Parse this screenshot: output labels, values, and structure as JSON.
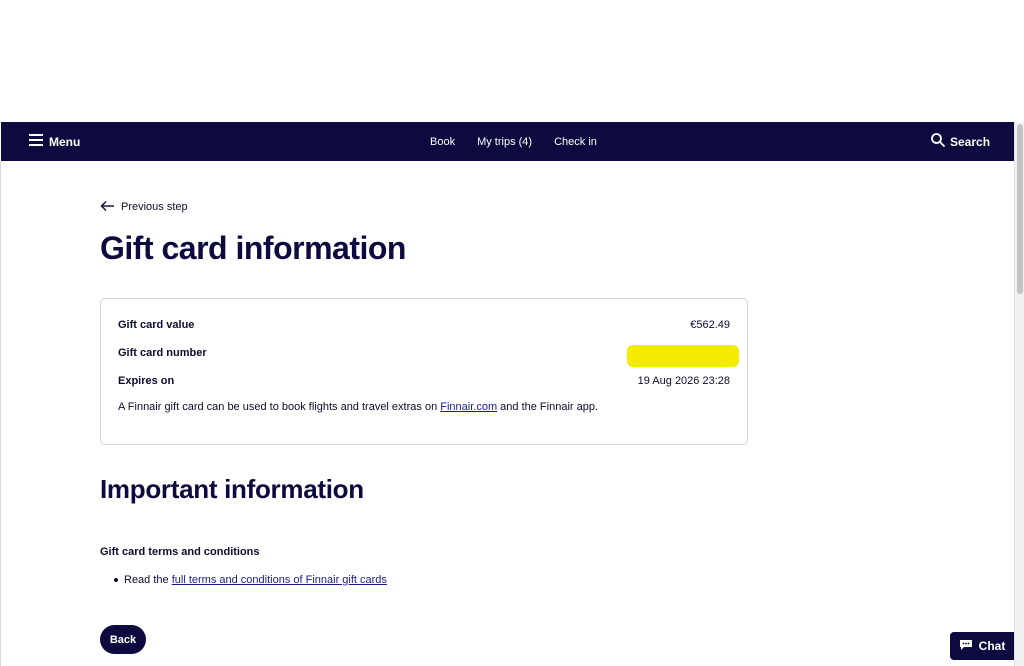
{
  "nav": {
    "menu_label": "Menu",
    "links": [
      "Book",
      "My trips (4)",
      "Check in"
    ],
    "search_label": "Search"
  },
  "page": {
    "previous_step": "Previous step",
    "title": "Gift card information"
  },
  "gift_card": {
    "value_label": "Gift card value",
    "value": "€562.49",
    "number_label": "Gift card number",
    "expires_label": "Expires on",
    "expires_value": "19 Aug 2026 23:28",
    "note_prefix": "A Finnair gift card can be used to book flights and travel extras on ",
    "note_link": "Finnair.com",
    "note_suffix": " and the Finnair app."
  },
  "important": {
    "title": "Important information",
    "terms_heading": "Gift card terms and conditions",
    "bullet_prefix": "Read the ",
    "bullet_link": "full terms and conditions of Finnair gift cards"
  },
  "actions": {
    "back_label": "Back",
    "chat_label": "Chat"
  },
  "colors": {
    "brand_navy": "#0c0a3e",
    "redaction": "#f3ec00"
  }
}
